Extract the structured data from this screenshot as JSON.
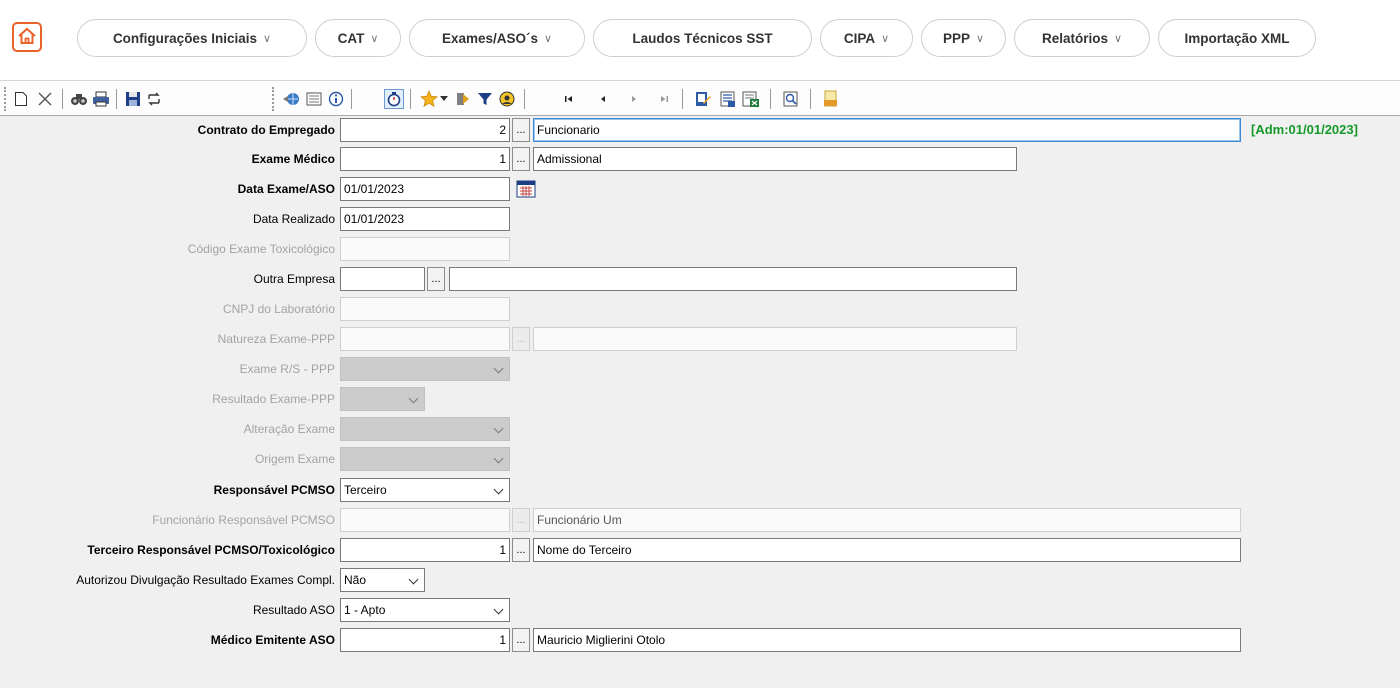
{
  "menu": {
    "items": [
      {
        "label": "Configurações Iniciais",
        "dropdown": true
      },
      {
        "label": "CAT",
        "dropdown": true
      },
      {
        "label": "Exames/ASO´s",
        "dropdown": true
      },
      {
        "label": "Laudos Técnicos SST",
        "dropdown": false
      },
      {
        "label": "CIPA",
        "dropdown": true
      },
      {
        "label": "PPP",
        "dropdown": true
      },
      {
        "label": "Relatórios",
        "dropdown": true
      },
      {
        "label": "Importação XML",
        "dropdown": false
      }
    ],
    "chevron": "∨",
    "accent": "#e8642c"
  },
  "toolbar": {
    "icons": [
      "new-record-icon",
      "delete-record-icon",
      "find-icon",
      "print-icon",
      "save-icon",
      "refresh-icon",
      "globe-icon",
      "list-icon",
      "info-icon",
      "timer-icon",
      "favorites-icon",
      "dropdown-arrow-icon",
      "exit-icon",
      "filter-icon",
      "user-help-icon",
      "first-record-icon",
      "previous-record-icon",
      "next-record-icon",
      "last-record-icon",
      "edit-icon",
      "report-icon",
      "report-export-icon",
      "preview-icon",
      "xml-icon"
    ]
  },
  "form": {
    "contrato": {
      "label": "Contrato do Empregado",
      "code": "2",
      "value": "Funcionario",
      "admission": "[Adm:01/01/2023]"
    },
    "exame_medico": {
      "label": "Exame Médico",
      "code": "1",
      "value": "Admissional"
    },
    "data_exame": {
      "label": "Data Exame/ASO",
      "value": "01/01/2023"
    },
    "data_realizado": {
      "label": "Data Realizado",
      "value": "01/01/2023"
    },
    "codigo_toxicologico": {
      "label": "Código Exame Toxicológico",
      "value": ""
    },
    "outra_empresa": {
      "label": "Outra Empresa",
      "code": "",
      "value": ""
    },
    "cnpj_laboratorio": {
      "label": "CNPJ do Laboratório",
      "value": ""
    },
    "natureza_exame": {
      "label": "Natureza Exame-PPP",
      "code": "",
      "value": ""
    },
    "exame_rs": {
      "label": "Exame R/S - PPP",
      "value": ""
    },
    "resultado_exame_ppp": {
      "label": "Resultado Exame-PPP",
      "value": ""
    },
    "alteracao_exame": {
      "label": "Alteração Exame",
      "value": ""
    },
    "origem_exame": {
      "label": "Origem Exame",
      "value": ""
    },
    "responsavel_pcmso": {
      "label": "Responsável PCMSO",
      "value": "Terceiro"
    },
    "funcionario_responsavel": {
      "label": "Funcionário Responsável PCMSO",
      "code": "",
      "value": "Funcionário Um"
    },
    "terceiro_responsavel": {
      "label": "Terceiro Responsável PCMSO/Toxicológico",
      "code": "1",
      "value": "Nome do Terceiro"
    },
    "autorizou_divulgacao": {
      "label": "Autorizou Divulgação Resultado Exames Compl.",
      "value": "Não"
    },
    "resultado_aso": {
      "label": "Resultado ASO",
      "value": "1 - Apto"
    },
    "medico_emitente": {
      "label": "Médico Emitente ASO",
      "code": "1",
      "value": "Mauricio Miglierini Otolo"
    },
    "ellipsis": "...",
    "admission_color": "#159a2a"
  }
}
